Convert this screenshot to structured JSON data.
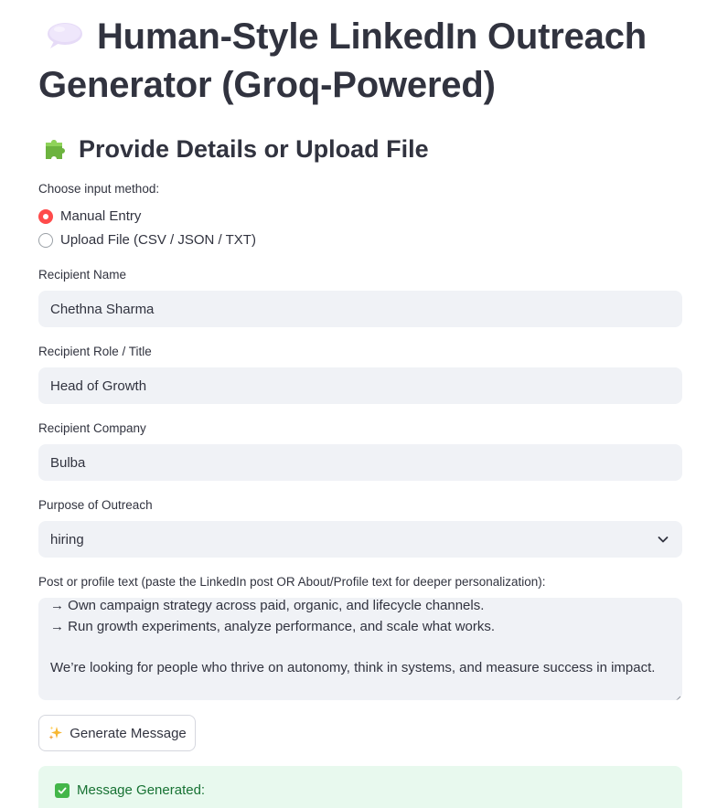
{
  "header": {
    "title": "Human-Style LinkedIn Outreach Generator (Groq-Powered)",
    "title_icon": "speech-bubble-icon"
  },
  "section": {
    "title": "Provide Details or Upload File",
    "icon": "puzzle-piece-icon"
  },
  "input_method": {
    "label": "Choose input method:",
    "options": [
      {
        "label": "Manual Entry",
        "selected": true
      },
      {
        "label": "Upload File (CSV / JSON / TXT)",
        "selected": false
      }
    ]
  },
  "fields": {
    "recipient_name": {
      "label": "Recipient Name",
      "value": "Chethna Sharma"
    },
    "recipient_role": {
      "label": "Recipient Role / Title",
      "value": "Head of Growth"
    },
    "recipient_company": {
      "label": "Recipient Company",
      "value": "Bulba"
    },
    "purpose": {
      "label": "Purpose of Outreach",
      "value": "hiring"
    },
    "post_text": {
      "label": "Post or profile text (paste the LinkedIn post OR About/Profile text for deeper personalization):",
      "value": "→ Own campaign strategy across paid, organic, and lifecycle channels.\n→ Run growth experiments, analyze performance, and scale what works.\n\nWe’re looking for people who thrive on autonomy, think in systems, and measure success in impact."
    }
  },
  "actions": {
    "generate_label": "Generate Message",
    "generate_icon": "sparkles-icon"
  },
  "status": {
    "message": "Message Generated:",
    "icon": "check-mark-icon"
  },
  "colors": {
    "accent": "#ff4b4b",
    "input_bg": "#f0f2f6",
    "text": "#31333f",
    "success_bg": "#e8f9ee",
    "success_text": "#177233"
  }
}
